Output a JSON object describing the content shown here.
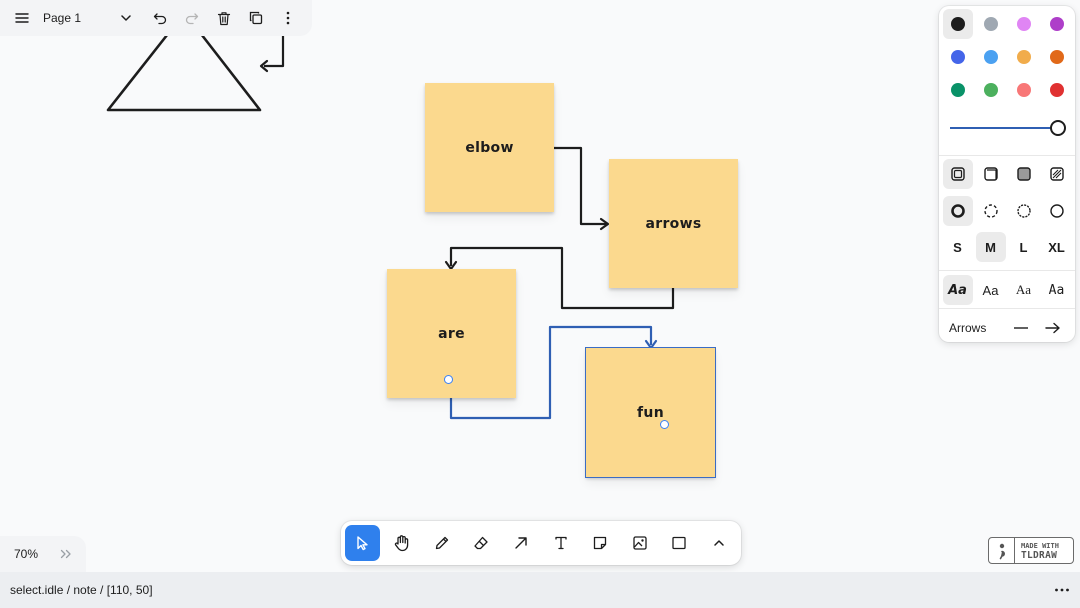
{
  "menu": {
    "page_name": "Page 1",
    "icons": [
      "hamburger-menu-icon",
      "chevron-down-icon",
      "undo-icon",
      "redo-icon",
      "trash-icon",
      "duplicate-icon",
      "more-vertical-icon"
    ]
  },
  "canvas": {
    "notes": [
      {
        "id": "elbow",
        "text": "elbow",
        "selected": false
      },
      {
        "id": "arrows",
        "text": "arrows",
        "selected": false
      },
      {
        "id": "are",
        "text": "are",
        "selected": false
      },
      {
        "id": "fun",
        "text": "fun",
        "selected": true
      }
    ],
    "note_color": "#fbd98e",
    "arrow_color_default": "#1d1d1d",
    "arrow_color_selected": "#2f5fb3"
  },
  "style_panel": {
    "colors": [
      "#1d1d1d",
      "#9fa8b2",
      "#e085f4",
      "#ae3ec9",
      "#4465e9",
      "#4ba1f1",
      "#f1ac4b",
      "#e16919",
      "#099268",
      "#4cb05e",
      "#f87777",
      "#e03131"
    ],
    "opacity": "100%",
    "fill_icons": [
      "fill-none-icon",
      "fill-semi-icon",
      "fill-solid-icon",
      "fill-pattern-icon"
    ],
    "dash_icons": [
      "dash-draw-icon",
      "dash-dashed-icon",
      "dash-dotted-icon",
      "dash-solid-icon"
    ],
    "sizes": [
      "S",
      "M",
      "L",
      "XL"
    ],
    "selected_size": "M",
    "fonts": [
      "Aa",
      "Aa",
      "Aa",
      "Aa"
    ],
    "arrows_label": "Arrows"
  },
  "toolbar": {
    "tools": [
      "select-tool-icon",
      "hand-tool-icon",
      "draw-tool-icon",
      "eraser-tool-icon",
      "arrow-tool-icon",
      "text-tool-icon",
      "note-tool-icon",
      "asset-tool-icon",
      "rectangle-tool-icon",
      "chevron-up-icon"
    ],
    "active_tool": "select",
    "accent": "#2f80ed"
  },
  "zoom": {
    "value": "70%"
  },
  "watermark": {
    "line1": "MADE WITH",
    "line2": "TLDRAW"
  },
  "status_bar": {
    "text": "select.idle / note / [110, 50]"
  }
}
